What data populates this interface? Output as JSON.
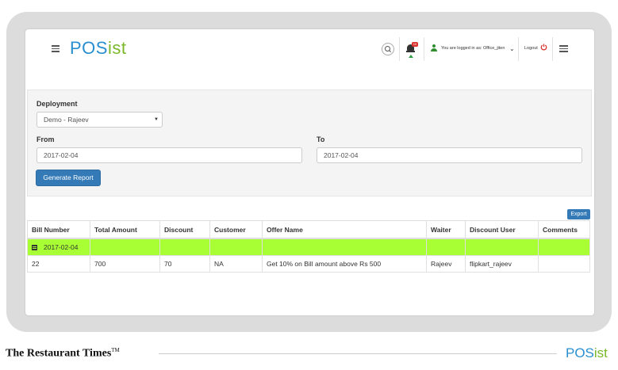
{
  "app": {
    "logo_main": "POS",
    "logo_accent": "ist"
  },
  "topbar": {
    "notification_count": "10",
    "logged_in_text": "You are logged in as: Office_jiten",
    "logout_label": "Logout"
  },
  "filters": {
    "deployment_label": "Deployment",
    "deployment_value": "Demo - Rajeev",
    "from_label": "From",
    "from_value": "2017-02-04",
    "to_label": "To",
    "to_value": "2017-02-04",
    "generate_label": "Generate Report"
  },
  "export_label": "Export",
  "table": {
    "headers": [
      "Bill Number",
      "Total Amount",
      "Discount",
      "Customer",
      "Offer Name",
      "Waiter",
      "Discount User",
      "Comments"
    ],
    "group_date": "2017-02-04",
    "rows": [
      [
        "22",
        "700",
        "70",
        "NA",
        "Get 10% on Bill amount above Rs 500",
        "Rajeev",
        "flipkart_rajeev",
        ""
      ]
    ]
  },
  "footer": {
    "title": "The Restaurant Times",
    "trademark": "TM",
    "logo_main": "POS",
    "logo_accent": "ist"
  },
  "colors": {
    "brand_blue": "#2a8fcf",
    "brand_green": "#7ab829",
    "button_blue": "#337ab7",
    "highlight_row": "#a8ff33"
  }
}
